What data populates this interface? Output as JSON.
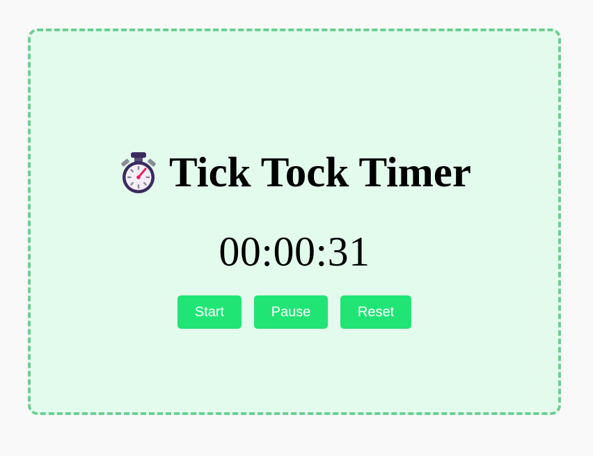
{
  "app": {
    "title": "Tick Tock Timer",
    "title_icon": "stopwatch-icon",
    "time": "00:00:31"
  },
  "controls": {
    "start_label": "Start",
    "pause_label": "Pause",
    "reset_label": "Reset"
  },
  "colors": {
    "page_background": "#f9f9f9",
    "card_background": "#e3fbec",
    "card_border": "#6cce94",
    "button_background": "#20e574",
    "button_text": "#ffffff"
  }
}
